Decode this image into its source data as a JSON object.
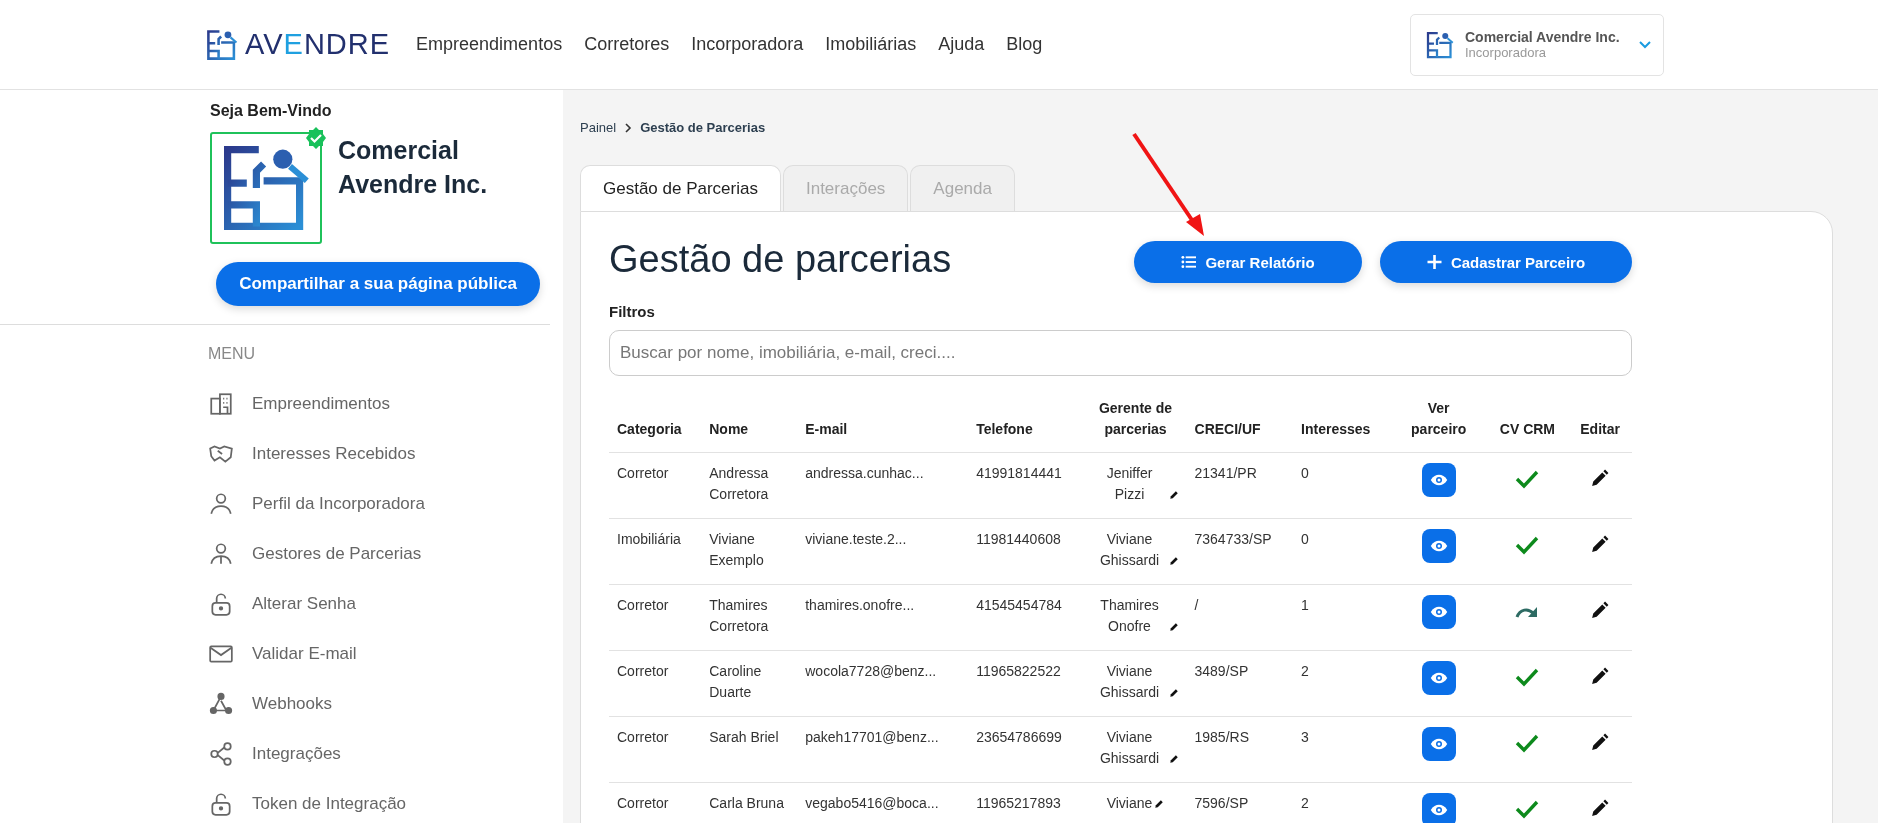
{
  "header": {
    "logo": [
      {
        "text": "AV",
        "accent": false
      },
      {
        "text": "E",
        "accent": true
      },
      {
        "text": "NDRE",
        "accent": false
      }
    ],
    "nav": [
      "Empreendimentos",
      "Corretores",
      "Incorporadora",
      "Imobiliárias",
      "Ajuda",
      "Blog"
    ],
    "account": {
      "name": "Comercial Avendre Inc.",
      "role": "Incorporadora"
    }
  },
  "sidebar": {
    "greeting": "Seja Bem-Vindo",
    "verified": true,
    "company": "Comercial Avendre Inc.",
    "share_button": "Compartilhar a sua página pública",
    "menu_title": "MENU",
    "items": [
      {
        "label": "Empreendimentos"
      },
      {
        "label": "Interesses Recebidos"
      },
      {
        "label": "Perfil da Incorporadora"
      },
      {
        "label": "Gestores de Parcerias"
      },
      {
        "label": "Alterar Senha"
      },
      {
        "label": "Validar E-mail"
      },
      {
        "label": "Webhooks"
      },
      {
        "label": "Integrações"
      },
      {
        "label": "Token de Integração"
      }
    ]
  },
  "breadcrumb": [
    "Painel",
    "Gestão de Parcerias"
  ],
  "tabs": [
    {
      "label": "Gestão de Parcerias",
      "selected": true
    },
    {
      "label": "Interações",
      "selected": false
    },
    {
      "label": "Agenda",
      "selected": false
    }
  ],
  "title": "Gestão de parcerias",
  "buttons": [
    "Gerar Relatório",
    "Cadastrar Parceiro"
  ],
  "filters": {
    "label": "Filtros",
    "placeholder": "Buscar por nome, imobiliária, e-mail, creci...."
  },
  "table": {
    "columns": [
      "Categoria",
      "Nome",
      "E-mail",
      "Telefone",
      "Gerente de parcerias",
      "CRECI/UF",
      "Interesses",
      "Ver parceiro",
      "CV CRM",
      "Editar"
    ],
    "rows": [
      {
        "categoria": "Corretor",
        "nome": "Andressa Corretora",
        "email": "andressa.cunhac...",
        "telefone": "41991814441",
        "gerente": "Jeniffer Pizzi",
        "creci": "21341/PR",
        "interesses": "0",
        "crm_synced": true
      },
      {
        "categoria": "Imobiliária",
        "nome": "Viviane Exemplo",
        "email": "viviane.teste.2...",
        "telefone": "11981440608",
        "gerente": "Viviane Ghissardi",
        "creci": "7364733/SP",
        "interesses": "0",
        "crm_synced": true
      },
      {
        "categoria": "Corretor",
        "nome": "Thamires Corretora",
        "email": "thamires.onofre...",
        "telefone": "41545454784",
        "gerente": "Thamires Onofre",
        "creci": "/",
        "interesses": "1",
        "crm_synced": false
      },
      {
        "categoria": "Corretor",
        "nome": "Caroline Duarte",
        "email": "wocola7728@benz...",
        "telefone": "11965822522",
        "gerente": "Viviane Ghissardi",
        "creci": "3489/SP",
        "interesses": "2",
        "crm_synced": true
      },
      {
        "categoria": "Corretor",
        "nome": "Sarah Briel",
        "email": "pakeh17701@benz...",
        "telefone": "23654786699",
        "gerente": "Viviane Ghissardi",
        "creci": "1985/RS",
        "interesses": "3",
        "crm_synced": true
      },
      {
        "categoria": "Corretor",
        "nome": "Carla Bruna",
        "email": "vegabo5416@boca...",
        "telefone": "11965217893",
        "gerente": "Viviane",
        "creci": "7596/SP",
        "interesses": "2",
        "crm_synced": true
      }
    ]
  }
}
